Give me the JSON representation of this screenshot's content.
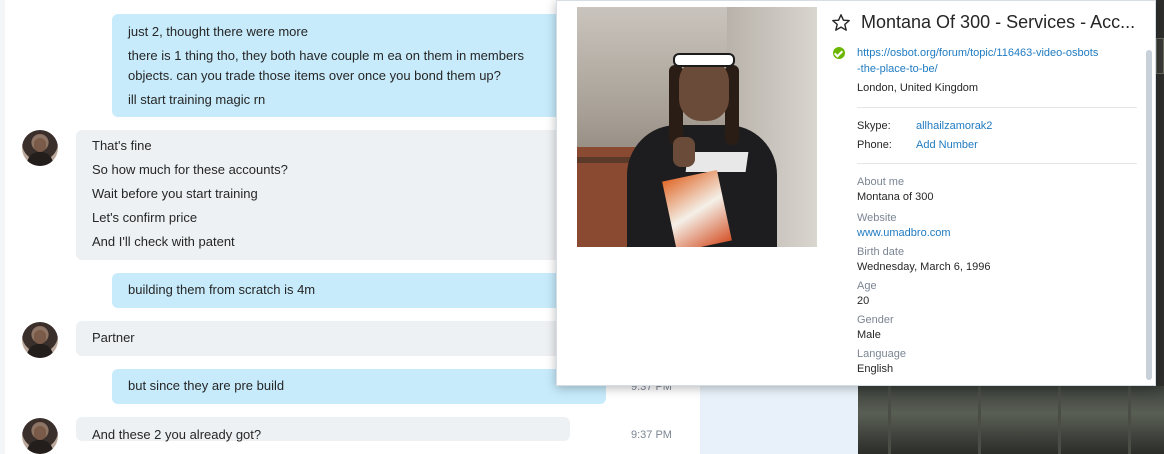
{
  "chat": {
    "messages": [
      {
        "direction": "out",
        "lines": [
          "just 2, thought there were more",
          "there is 1 thing tho, they both have couple m ea on them in members",
          "objects. can you trade those items over once you bond them up?",
          "ill start training magic rn"
        ]
      },
      {
        "direction": "in",
        "lines": [
          "That's fine",
          "So how much for these accounts?",
          "Wait before you start training",
          "Let's confirm price",
          "And I'll check with patent"
        ]
      },
      {
        "direction": "out",
        "lines": [
          "building them from scratch is 4m"
        ]
      },
      {
        "direction": "in",
        "lines": [
          "Partner"
        ]
      },
      {
        "direction": "out",
        "lines": [
          "but since they are pre build"
        ],
        "time": "9:37 PM"
      },
      {
        "direction": "in",
        "lines": [
          "And these 2 you already got?"
        ],
        "time": "9:37 PM"
      }
    ]
  },
  "profile": {
    "name": "Montana Of 300 - Services - Acc...",
    "mood_lines": [
      "https://osbot.org/forum/topic/116463-video-osbots",
      "-the-place-to-be/"
    ],
    "location": "London, United Kingdom",
    "skype_label": "Skype:",
    "skype_value": "allhailzamorak2",
    "phone_label": "Phone:",
    "phone_value": "Add Number",
    "details": [
      {
        "key": "About me",
        "value": "Montana of 300"
      },
      {
        "key": "Website",
        "value": "www.umadbro.com",
        "link": true
      },
      {
        "key": "Birth date",
        "value": "Wednesday, March 6, 1996"
      },
      {
        "key": "Age",
        "value": "20"
      },
      {
        "key": "Gender",
        "value": "Male"
      },
      {
        "key": "Language",
        "value": "English"
      }
    ],
    "icons": {
      "favorite": "star-outline-icon",
      "presence": "online-check-icon"
    },
    "colors": {
      "link": "#1f7bc1",
      "online": "#6bb700",
      "outgoing_bubble": "#c7ebfb",
      "incoming_bubble": "#eef1f4"
    }
  }
}
